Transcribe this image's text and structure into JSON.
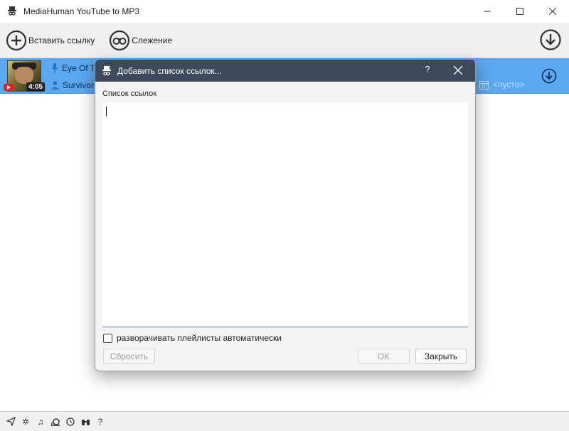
{
  "window": {
    "title": "MediaHuman YouTube to MP3",
    "minimize_icon": "minimize-icon",
    "maximize_icon": "maximize-icon",
    "close_icon": "close-icon"
  },
  "toolbar": {
    "paste_label": "Вставить ссылку",
    "watch_label": "Слежение",
    "download_icon": "download-all-icon"
  },
  "track": {
    "title": "Eye Of Tl",
    "artist": "Survivor",
    "duration": "4:05",
    "album_placeholder": "<пусто>"
  },
  "dialog": {
    "title": "Добавить список ссылок...",
    "help": "?",
    "label": "Список ссылок",
    "textarea_value": "",
    "checkbox_label": "разворачивать плейлисты автоматически",
    "checkbox_checked": false,
    "reset_label": "Сбросить",
    "ok_label": "OK",
    "close_label": "Закрыть"
  },
  "colors": {
    "accent_row": "#5aa8f0",
    "dialog_titlebar": "#3c4a5c"
  }
}
